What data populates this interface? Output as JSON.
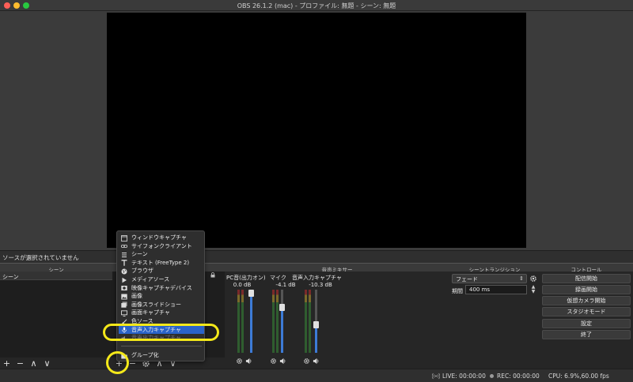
{
  "window": {
    "title": "OBS 26.1.2 (mac) - プロファイル: 無題 - シーン: 無題"
  },
  "status_strip": {
    "text": "ソースが選択されていません"
  },
  "docks": {
    "scenes_title": "シーン",
    "sources_title": "ソース",
    "mixer_title": "音声ミキサー",
    "transitions_title": "シーントランジション",
    "controls_title": "コントロール"
  },
  "scenes": {
    "header": "シーン"
  },
  "toolbar_glyphs": {
    "add": "+",
    "remove": "−",
    "up": "∧",
    "down": "∨"
  },
  "context_menu": {
    "items": [
      {
        "label": "ウィンドウキャプチャ",
        "icon": "window-icon"
      },
      {
        "label": "サイフォンクライアント",
        "icon": "link-icon"
      },
      {
        "label": "シーン",
        "icon": "list-icon"
      },
      {
        "label": "テキスト (FreeType 2)",
        "icon": "text-icon"
      },
      {
        "label": "ブラウザ",
        "icon": "globe-icon"
      },
      {
        "label": "メディアソース",
        "icon": "play-icon"
      },
      {
        "label": "映像キャプチャデバイス",
        "icon": "camera-icon"
      },
      {
        "label": "画像",
        "icon": "image-icon"
      },
      {
        "label": "画像スライドショー",
        "icon": "slideshow-icon"
      },
      {
        "label": "画面キャプチャ",
        "icon": "monitor-icon"
      },
      {
        "label": "色ソース",
        "icon": "brush-icon"
      },
      {
        "label": "音声入力キャプチャ",
        "icon": "mic-icon",
        "selected": true
      },
      {
        "label": "音声出力キャプチャ",
        "icon": "speaker-icon"
      }
    ],
    "group_label": "グループ化"
  },
  "mixer": {
    "channels": [
      {
        "name": "PC音(出力オン)",
        "db": "0.0 dB",
        "volume": 1.0
      },
      {
        "name": "マイク",
        "db": "-4.1 dB",
        "volume": 0.72
      },
      {
        "name": "音声入力キャプチャ",
        "db": "-10.3 dB",
        "volume": 0.45
      }
    ]
  },
  "transitions": {
    "selected": "フェード",
    "duration_label": "期間",
    "duration_value": "400 ms"
  },
  "controls": {
    "buttons": [
      "配信開始",
      "録画開始",
      "仮想カメラ開始",
      "スタジオモード",
      "設定",
      "終了"
    ]
  },
  "statusbar": {
    "live": "LIVE: 00:00:00",
    "rec": "REC: 00:00:00",
    "cpu": "CPU: 6.9%,60.00 fps"
  },
  "colors": {
    "selection": "#2a63c9",
    "highlight": "#f4e81a",
    "volume": "#3d7bd6"
  }
}
